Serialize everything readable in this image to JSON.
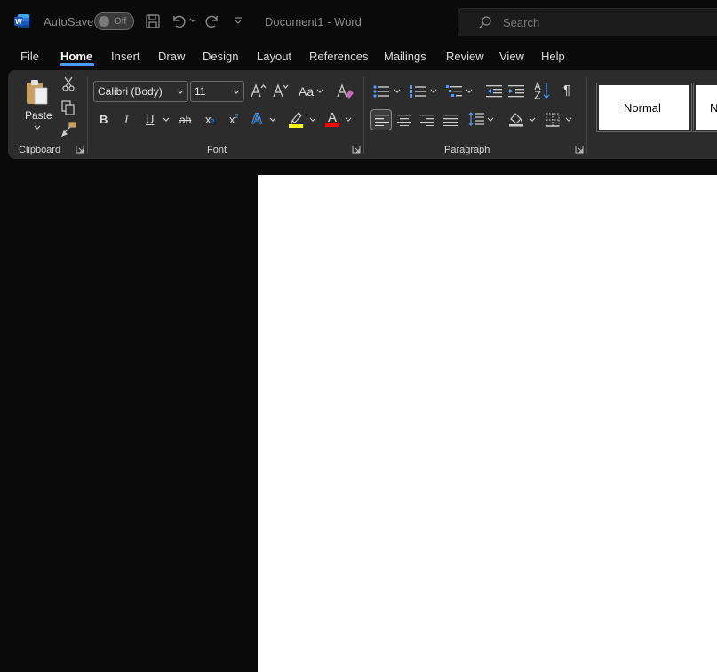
{
  "titlebar": {
    "autosave_label": "AutoSave",
    "autosave_state": "Off",
    "document_title": "Document1 - Word",
    "search_placeholder": "Search"
  },
  "menu_tabs": [
    "File",
    "Home",
    "Insert",
    "Draw",
    "Design",
    "Layout",
    "References",
    "Mailings",
    "Review",
    "View",
    "Help"
  ],
  "active_tab": "Home",
  "ribbon": {
    "clipboard": {
      "paste_label": "Paste",
      "group_label": "Clipboard"
    },
    "font": {
      "font_name": "Calibri (Body)",
      "font_size": "11",
      "change_case_label": "Aa",
      "bold_label": "B",
      "italic_label": "I",
      "underline_label": "U",
      "strike_label": "ab",
      "subscript_label": "x",
      "superscript_label": "x",
      "text_effects_label": "A",
      "font_color_label": "A",
      "group_label": "Font"
    },
    "paragraph": {
      "group_label": "Paragraph",
      "pilcrow": "¶"
    },
    "styles": {
      "normal_label": "Normal",
      "next_label": "N"
    }
  },
  "colors": {
    "accent": "#4f9bff",
    "highlight": "#ffff00",
    "font_color": "#ff0000",
    "word_brand": "#2b579a"
  }
}
